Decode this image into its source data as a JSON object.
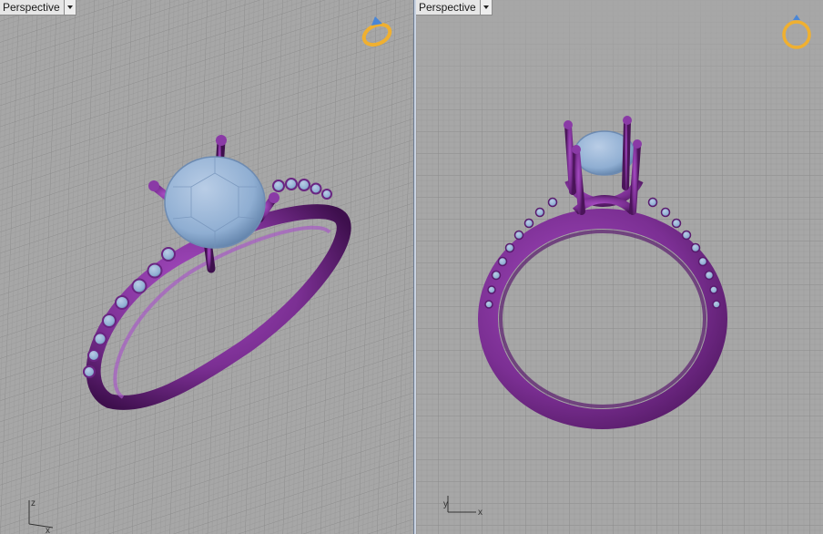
{
  "viewports": [
    {
      "label": "Perspective",
      "axes": {
        "z": "z",
        "x": "x"
      }
    },
    {
      "label": "Perspective",
      "axes": {
        "y": "y",
        "x": "x"
      }
    }
  ],
  "colors": {
    "grid_bg": "#a7a7a7",
    "grid_minor": "#8f8f8f",
    "grid_major": "#6d6d6d",
    "metal": "#7b2f93",
    "metal_dark": "#4a1459",
    "stone": "#8faed2",
    "widget": "#f0b030"
  },
  "icons": [
    "ring-view-widget-icon",
    "viewport-menu-chevron-icon",
    "axis-triad-icon"
  ]
}
